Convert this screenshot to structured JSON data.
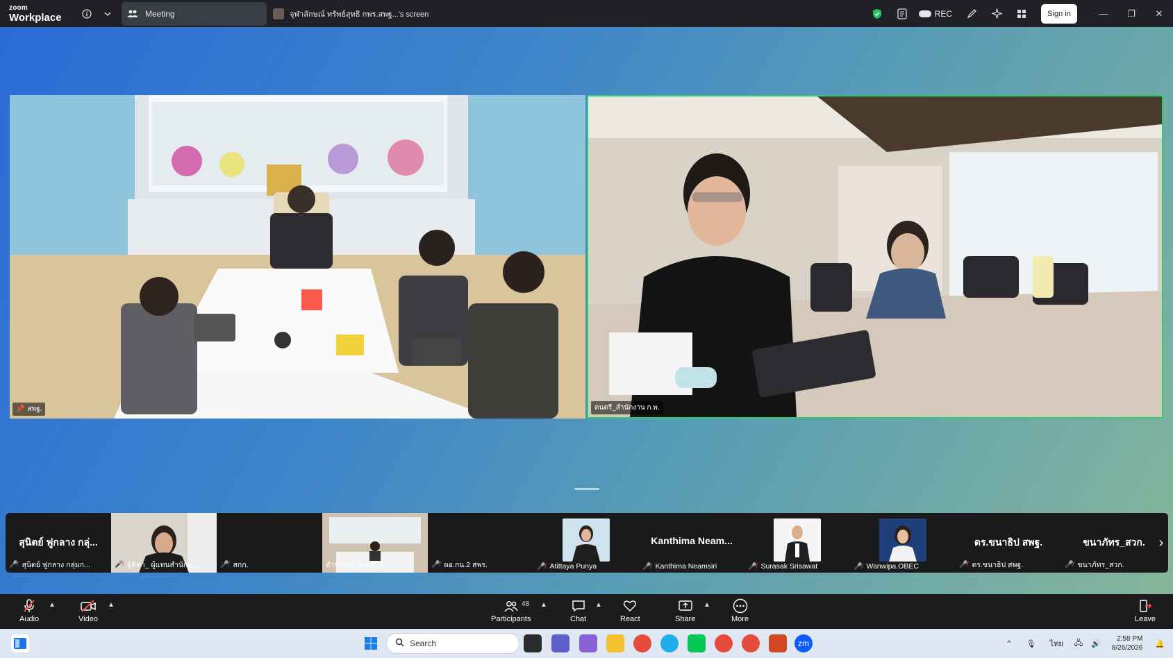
{
  "app": {
    "logo_small": "zoom",
    "logo_big": "Workplace",
    "meeting_tab_label": "Meeting",
    "screen_tab_label": "จุฬาลักษณ์ ทรัพย์สุทธิ กพร.สพฐ...'s screen",
    "rec_label": "REC",
    "signin_label": "Sign in"
  },
  "videos": {
    "left_name": "สพฐ.",
    "right_name": "ดนตรี_สำนักงาน ก.พ."
  },
  "gallery": [
    {
      "big_name": "สุนิตย์ ฟูกลาง กลุ่...",
      "label": "สุนิตย์ ฟูกลาง กลุ่มก...",
      "muted": true,
      "kind": "text"
    },
    {
      "big_name": "",
      "label": "ฐิติดา_ ผู้แทนสำนักง...",
      "muted": true,
      "kind": "photo"
    },
    {
      "big_name": "",
      "label": "สกก.",
      "muted": true,
      "kind": "blank"
    },
    {
      "big_name": "",
      "label": "สำนักงาน ก.พ.ร. 2",
      "muted": false,
      "kind": "room"
    },
    {
      "big_name": "",
      "label": "ผอ.กน.2 สพร.",
      "muted": true,
      "kind": "blank"
    },
    {
      "big_name": "",
      "label": "Atittaya Punya",
      "muted": true,
      "kind": "portrait"
    },
    {
      "big_name": "Kanthima  Neam...",
      "label": "Kanthima Neamsiri",
      "muted": true,
      "kind": "text"
    },
    {
      "big_name": "",
      "label": "Surasak Srisawat",
      "muted": true,
      "kind": "portrait2"
    },
    {
      "big_name": "",
      "label": "Wanwipa.OBEC",
      "muted": true,
      "kind": "portrait3"
    },
    {
      "big_name": "ดร.ขนาธิป สพฐ.",
      "label": "ดร.ขนาธิป สพฐ.",
      "muted": true,
      "kind": "text"
    },
    {
      "big_name": "ขนาภัทร_สวก.",
      "label": "ขนาภัทร_สวก.",
      "muted": true,
      "kind": "text"
    }
  ],
  "controls": {
    "audio": "Audio",
    "video": "Video",
    "participants": "Participants",
    "participants_count": "48",
    "chat": "Chat",
    "react": "React",
    "share": "Share",
    "more": "More",
    "leave": "Leave"
  },
  "taskbar": {
    "search_placeholder": "Search",
    "lang": "ไทย",
    "time": "2:58 PM",
    "date": "8/26/2026"
  }
}
